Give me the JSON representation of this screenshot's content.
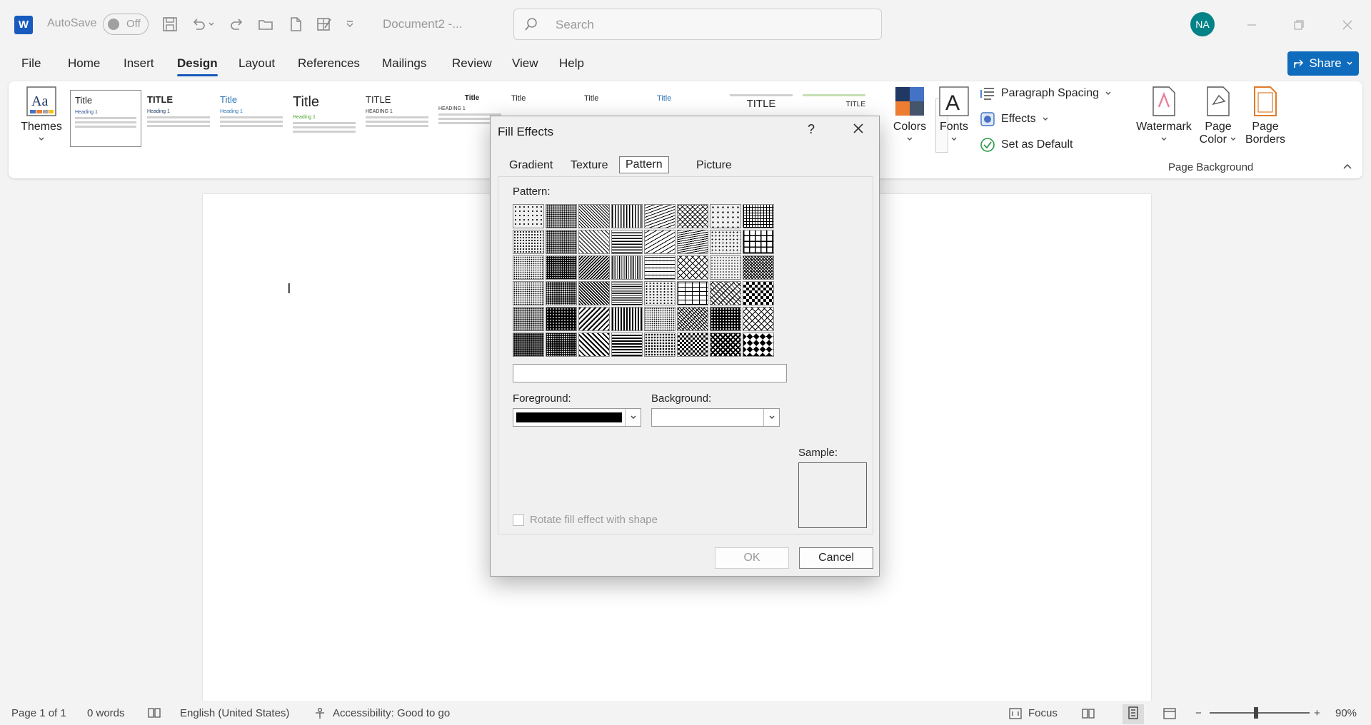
{
  "titlebar": {
    "app_logo": "W",
    "autosave_label": "AutoSave",
    "autosave_state": "Off",
    "document_title": "Document2 -...",
    "search_placeholder": "Search",
    "avatar_initials": "NA",
    "avatar_color": "#038387"
  },
  "menu": {
    "items": [
      "File",
      "Home",
      "Insert",
      "Design",
      "Layout",
      "References",
      "Mailings",
      "Review",
      "View",
      "Help"
    ],
    "active": "Design",
    "share_label": "Share"
  },
  "ribbon": {
    "themes_label": "Themes",
    "style_gallery": [
      {
        "title": "Title",
        "heading": "Heading 1"
      },
      {
        "title": "TITLE",
        "heading": "Heading 1"
      },
      {
        "title": "Title",
        "heading": "Heading 1"
      },
      {
        "title": "Title",
        "heading": "Heading 1"
      },
      {
        "title": "TITLE",
        "heading": "HEADING 1"
      },
      {
        "title": "Title",
        "heading": "HEADING 1"
      },
      {
        "title": "Title",
        "heading": ""
      },
      {
        "title": "Title",
        "heading": ""
      },
      {
        "title": "Title",
        "heading": ""
      },
      {
        "title": "TITLE",
        "heading": ""
      },
      {
        "title": "TITLE",
        "heading": ""
      }
    ],
    "colors_label": "Colors",
    "fonts_label": "Fonts",
    "paragraph_spacing_label": "Paragraph Spacing",
    "effects_label": "Effects",
    "set_default_label": "Set as Default",
    "watermark_label": "Watermark",
    "page_color_label_1": "Page",
    "page_color_label_2": "Color",
    "page_borders_label_1": "Page",
    "page_borders_label_2": "Borders",
    "page_background_group": "Page Background"
  },
  "dialog": {
    "title": "Fill Effects",
    "help": "?",
    "tabs": [
      "Gradient",
      "Texture",
      "Pattern",
      "Picture"
    ],
    "active_tab": "Pattern",
    "pattern_label": "Pattern:",
    "foreground_label": "Foreground:",
    "foreground_color": "#000000",
    "background_label": "Background:",
    "sample_label": "Sample:",
    "rotate_label": "Rotate fill effect with shape",
    "ok_label": "OK",
    "cancel_label": "Cancel"
  },
  "statusbar": {
    "page": "Page 1 of 1",
    "words": "0 words",
    "language": "English (United States)",
    "accessibility": "Accessibility: Good to go",
    "focus": "Focus",
    "zoom": "90%"
  }
}
